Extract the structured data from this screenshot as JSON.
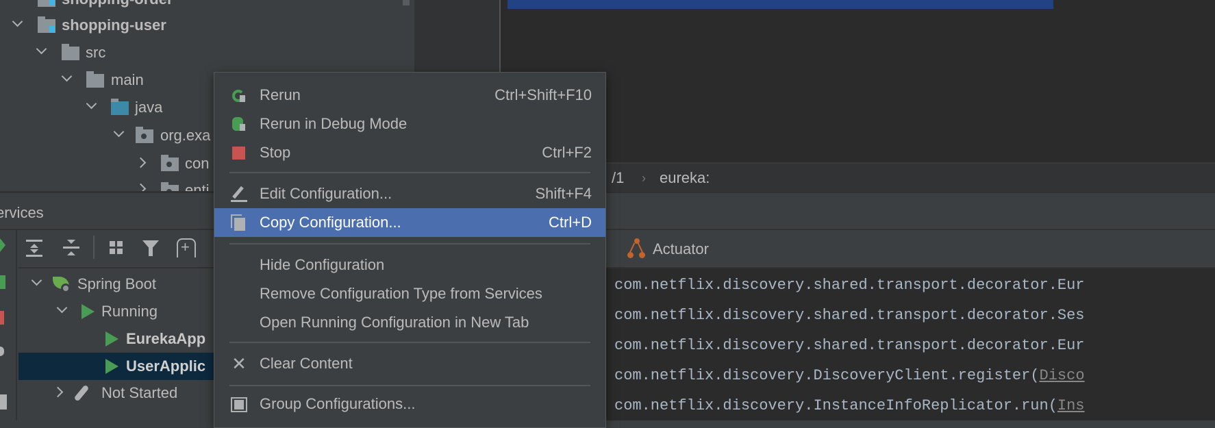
{
  "project_tree": {
    "items": [
      {
        "label": "shopping-order",
        "bold": true
      },
      {
        "label": "shopping-user",
        "bold": true
      },
      {
        "label": "src"
      },
      {
        "label": "main"
      },
      {
        "label": "java"
      },
      {
        "label": "org.exa"
      },
      {
        "label": "con"
      },
      {
        "label": "enti"
      }
    ]
  },
  "services": {
    "title": "ervices",
    "tree": {
      "spring_boot": "Spring Boot",
      "running": "Running",
      "eureka": "EurekaApp",
      "user": "UserApplic",
      "not_started": "Not Started"
    }
  },
  "breadcrumb": {
    "part1": "/1",
    "sep": "›",
    "part2": "eureka:"
  },
  "tabs": {
    "actuator": "Actuator"
  },
  "console": {
    "lines": [
      {
        "text": "com.netflix.discovery.shared.transport.decorator.Eur",
        "link": ""
      },
      {
        "text": "com.netflix.discovery.shared.transport.decorator.Ses",
        "link": ""
      },
      {
        "text": "com.netflix.discovery.shared.transport.decorator.Eur",
        "link": ""
      },
      {
        "text": "com.netflix.discovery.DiscoveryClient.register(",
        "link": "Disco"
      },
      {
        "text": "com.netflix.discovery.InstanceInfoReplicator.run(",
        "link": "Ins"
      }
    ]
  },
  "context_menu": {
    "items": [
      {
        "label": "Rerun",
        "shortcut": "Ctrl+Shift+F10",
        "icon": "rerun-icon"
      },
      {
        "label": "Rerun in Debug Mode",
        "shortcut": "",
        "icon": "debug-icon"
      },
      {
        "label": "Stop",
        "shortcut": "Ctrl+F2",
        "icon": "stop-icon"
      },
      {
        "label": "Edit Configuration...",
        "shortcut": "Shift+F4",
        "icon": "edit-icon"
      },
      {
        "label": "Copy Configuration...",
        "shortcut": "Ctrl+D",
        "icon": "copy-icon",
        "selected": true
      },
      {
        "label": "Hide Configuration",
        "shortcut": ""
      },
      {
        "label": "Remove Configuration Type from Services",
        "shortcut": ""
      },
      {
        "label": "Open Running Configuration in New Tab",
        "shortcut": ""
      },
      {
        "label": "Clear Content",
        "shortcut": "",
        "icon": "close-icon"
      },
      {
        "label": "Group Configurations...",
        "shortcut": "",
        "icon": "group-icon"
      }
    ]
  },
  "colors": {
    "selection": "#4b6eaf",
    "running_green": "#499c54",
    "stop_red": "#c75450",
    "editor_bg": "#2b2b2b",
    "tree_selection": "#0d293e"
  }
}
